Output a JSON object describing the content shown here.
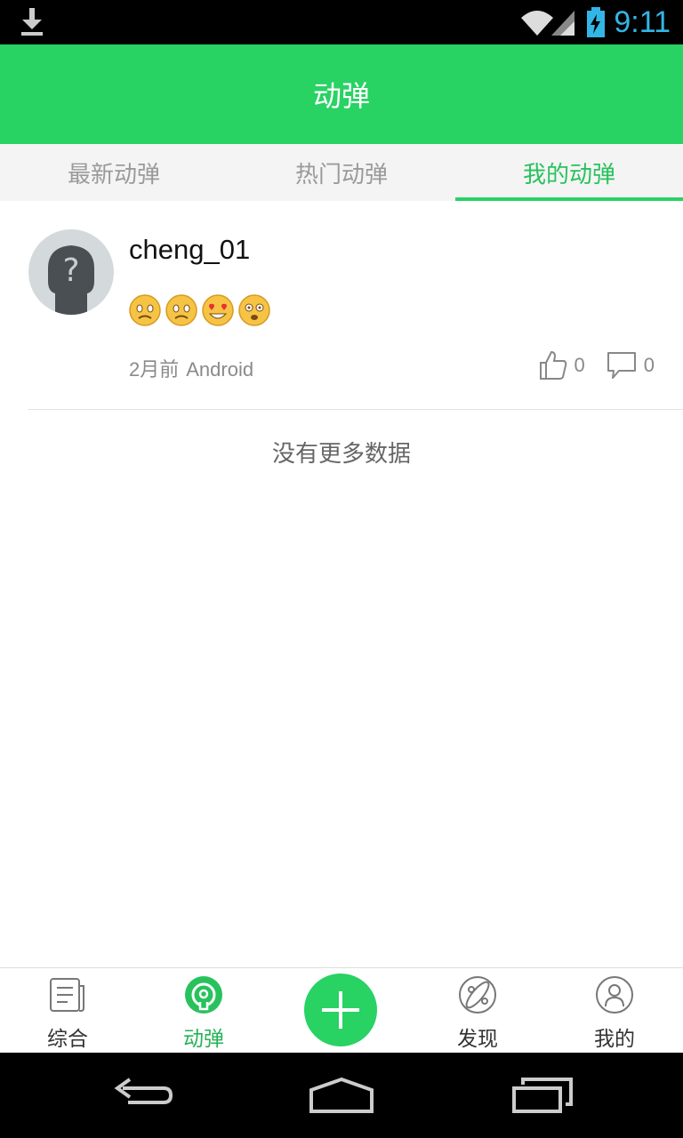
{
  "status_bar": {
    "time": "9:11",
    "icons": [
      "download-icon",
      "wifi-icon",
      "signal-icon",
      "battery-charging-icon"
    ]
  },
  "app_bar": {
    "title": "动弹"
  },
  "tabs": [
    {
      "label": "最新动弹",
      "active": false
    },
    {
      "label": "热门动弹",
      "active": false
    },
    {
      "label": "我的动弹",
      "active": true
    }
  ],
  "post": {
    "username": "cheng_01",
    "emojis": [
      "worried-face",
      "worried-face",
      "heart-eyes-face",
      "dizzy-face"
    ],
    "time_ago": "2月前",
    "source": "Android",
    "likes": "0",
    "comments": "0"
  },
  "list_footer": "没有更多数据",
  "bottom_nav": [
    {
      "label": "综合",
      "icon": "news-icon",
      "active": false
    },
    {
      "label": "动弹",
      "icon": "tweet-icon",
      "active": true
    },
    {
      "label": "",
      "icon": "plus-icon",
      "active": false
    },
    {
      "label": "发现",
      "icon": "planet-icon",
      "active": false
    },
    {
      "label": "我的",
      "icon": "profile-icon",
      "active": false
    }
  ],
  "colors": {
    "primary": "#28d263",
    "active_text": "#28c25d",
    "status_time": "#33b5e5"
  }
}
